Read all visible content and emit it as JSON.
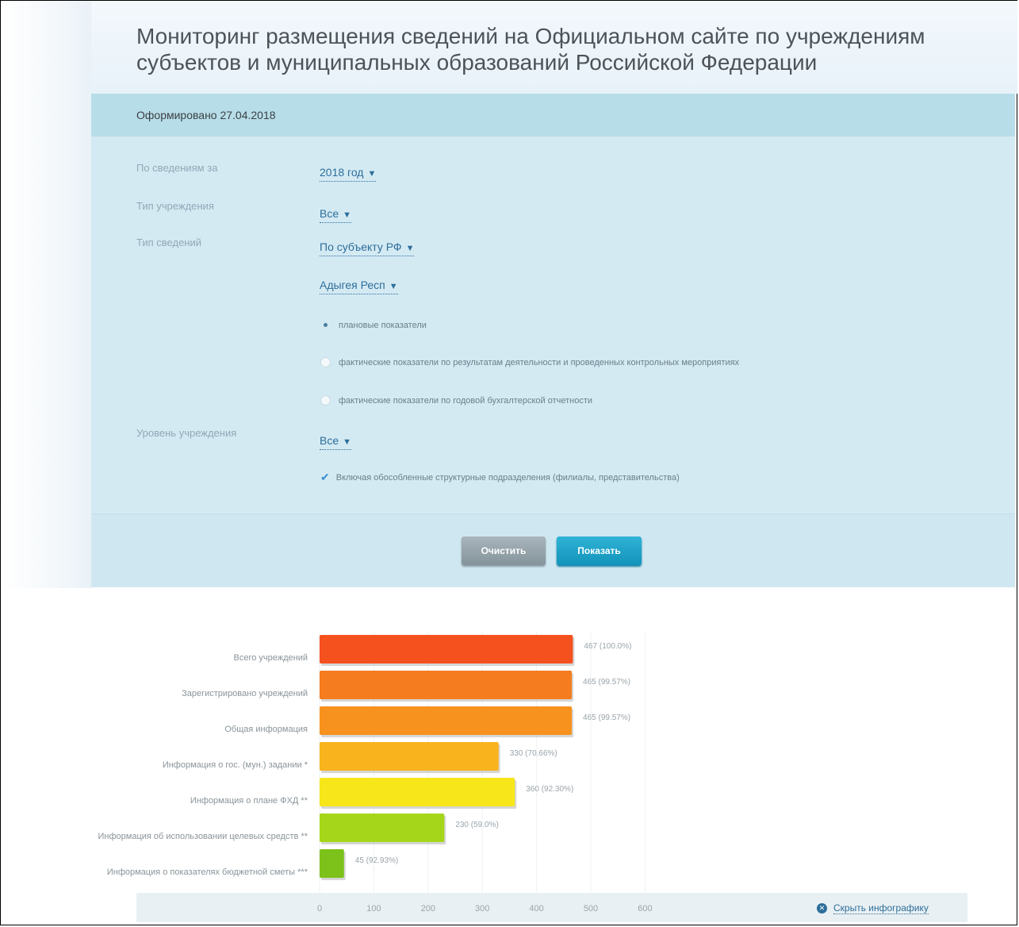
{
  "page": {
    "title": "Мониторинг размещения сведений на Официальном сайте по учреждениям субъектов и муниципальных образований Российской Федерации",
    "generated": "Оформировано 27.04.2018"
  },
  "filters": {
    "period_label": "По сведениям за",
    "period_value": "2018 год",
    "inst_type_label": "Тип учреждения",
    "inst_type_value": "Все",
    "info_type_label": "Тип сведений",
    "info_type_value": "По субъекту РФ",
    "region_value": "Адыгея Респ",
    "radio_options": [
      "плановые показатели",
      "фактические показатели по результатам деятельности и проведенных контрольных мероприятиях",
      "фактические показатели по годовой бухгалтерской отчетности"
    ],
    "radio_selected": 0,
    "level_label": "Уровень учреждения",
    "level_value": "Все",
    "include_branches": "Включая обособленные структурные подразделения (филиалы, представительства)"
  },
  "actions": {
    "clear_label": "Очистить",
    "show_label": "Показать"
  },
  "chart_data": {
    "type": "bar",
    "orientation": "horizontal",
    "categories": [
      "Всего учреждений",
      "Зарегистрировано учреждений",
      "Общая информация",
      "Информация о гос. (мун.) задании *",
      "Информация о плане ФХД **",
      "Информация об использовании целевых средств **",
      "Информация о показателях бюджетной сметы ***"
    ],
    "values": [
      467,
      465,
      465,
      330,
      360,
      230,
      45
    ],
    "data_labels": [
      "467 (100.0%)",
      "465 (99.57%)",
      "465 (99.57%)",
      "330 (70.66%)",
      "360 (92.30%)",
      "230 (59.0%)",
      "45 (92.93%)"
    ],
    "colors": [
      "#f4511e",
      "#f57c1f",
      "#f7921e",
      "#f9b31c",
      "#f6e61a",
      "#a6d61a",
      "#7cc21a"
    ],
    "xticks": [
      0,
      100,
      200,
      300,
      400,
      500,
      600
    ],
    "xlim": [
      0,
      600
    ],
    "grid": true,
    "hide_link": "Скрыть инфографику"
  }
}
